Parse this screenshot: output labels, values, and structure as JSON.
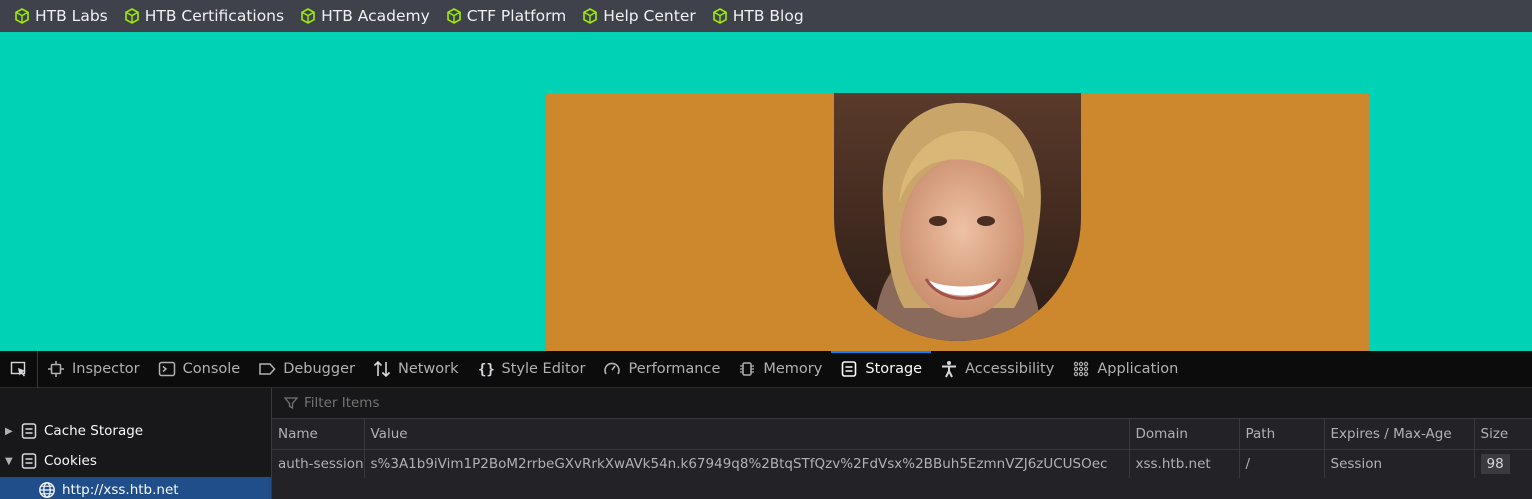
{
  "bookmarks": [
    {
      "label": "HTB Labs",
      "icon": "hackthebox-cube-icon"
    },
    {
      "label": "HTB Certifications",
      "icon": "hackthebox-cube-icon"
    },
    {
      "label": "HTB Academy",
      "icon": "hackthebox-cube-icon"
    },
    {
      "label": "CTF Platform",
      "icon": "hackthebox-cube-icon"
    },
    {
      "label": "Help Center",
      "icon": "hackthebox-cube-icon"
    },
    {
      "label": "HTB Blog",
      "icon": "hackthebox-cube-icon"
    }
  ],
  "colors": {
    "page_bg": "#00d2b5",
    "card_bg": "#cd882e",
    "bookmark_icon": "#9fef00",
    "active_tab_accent": "#0a84ff"
  },
  "devtools": {
    "tabs": [
      {
        "label": "Inspector",
        "icon": "inspector-icon"
      },
      {
        "label": "Console",
        "icon": "console-icon"
      },
      {
        "label": "Debugger",
        "icon": "debugger-icon"
      },
      {
        "label": "Network",
        "icon": "network-arrows-icon"
      },
      {
        "label": "Style Editor",
        "icon": "braces-icon"
      },
      {
        "label": "Performance",
        "icon": "gauge-icon"
      },
      {
        "label": "Memory",
        "icon": "memory-chip-icon"
      },
      {
        "label": "Storage",
        "icon": "storage-icon",
        "active": true
      },
      {
        "label": "Accessibility",
        "icon": "accessibility-icon"
      },
      {
        "label": "Application",
        "icon": "application-grid-icon"
      }
    ],
    "storage": {
      "tree": [
        {
          "label": "Cache Storage",
          "expanded": false
        },
        {
          "label": "Cookies",
          "expanded": true
        },
        {
          "label": "http://xss.htb.net",
          "selected": true
        }
      ],
      "filter_placeholder": "Filter Items",
      "columns": [
        "Name",
        "Value",
        "Domain",
        "Path",
        "Expires / Max-Age",
        "Size"
      ],
      "rows": [
        {
          "name": "auth-session",
          "value": "s%3A1b9iVim1P2BoM2rrbeGXvRrkXwAVk54n.k67949q8%2BtqSTfQzv%2FdVsx%2BBuh5EzmnVZJ6zUCUSOec",
          "domain": "xss.htb.net",
          "path": "/",
          "expires": "Session",
          "size": "98"
        }
      ]
    }
  }
}
